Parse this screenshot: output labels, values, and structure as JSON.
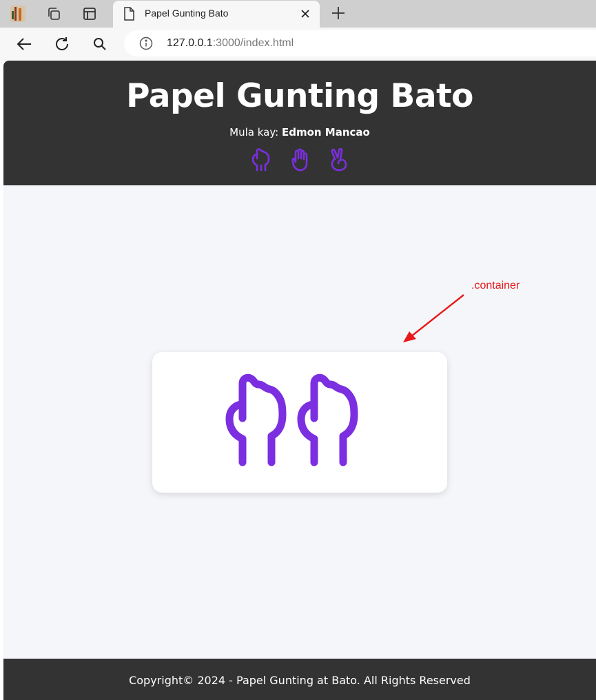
{
  "browser": {
    "tab_title": "Papel Gunting Bato",
    "url_host": "127.0.0.1",
    "url_rest": ":3000/index.html"
  },
  "header": {
    "title": "Papel Gunting Bato",
    "byline_prefix": "Mula kay: ",
    "author": "Edmon Mancao",
    "choices": [
      {
        "icon": "rock-icon"
      },
      {
        "icon": "paper-icon"
      },
      {
        "icon": "scissors-icon"
      }
    ]
  },
  "annotation": {
    "label": ".container"
  },
  "game": {
    "player_hand": "rock-icon",
    "computer_hand": "rock-icon"
  },
  "footer": {
    "text": "Copyright© 2024 - Papel Gunting at Bato. All Rights Reserved"
  },
  "colors": {
    "accent": "#7b2fe0",
    "header_bg": "#333333",
    "annotation": "#e8191c"
  }
}
